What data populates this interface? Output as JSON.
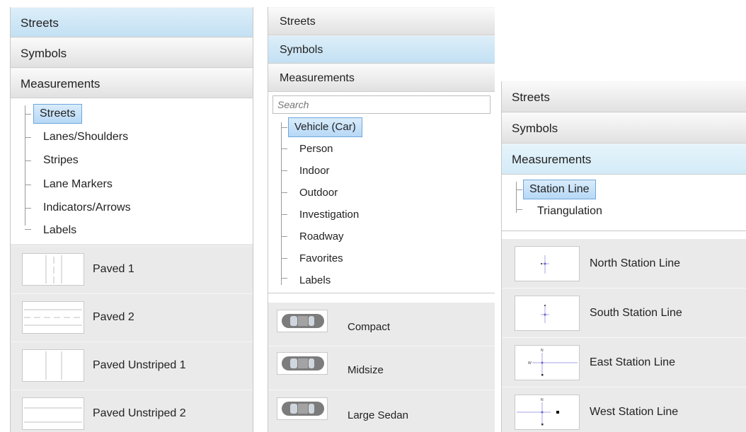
{
  "panel1": {
    "headers": [
      "Streets",
      "Symbols",
      "Measurements"
    ],
    "tree": [
      "Streets",
      "Lanes/Shoulders",
      "Stripes",
      "Lane Markers",
      "Indicators/Arrows",
      "Labels"
    ],
    "items": [
      "Paved 1",
      "Paved 2",
      "Paved Unstriped 1",
      "Paved Unstriped 2"
    ]
  },
  "panel2": {
    "headers": [
      "Streets",
      "Symbols",
      "Measurements"
    ],
    "search_placeholder": "Search",
    "tree": [
      "Vehicle (Car)",
      "Person",
      "Indoor",
      "Outdoor",
      "Investigation",
      "Roadway",
      "Favorites",
      "Labels"
    ],
    "items": [
      "Compact",
      "Midsize",
      "Large Sedan"
    ]
  },
  "panel3": {
    "headers": [
      "Streets",
      "Symbols",
      "Measurements"
    ],
    "tree": [
      "Station Line",
      "Triangulation"
    ],
    "items": [
      "North Station Line",
      "South Station Line",
      "East Station Line",
      "West Station Line"
    ],
    "compass_n": "N",
    "compass_w": "W"
  },
  "colors": {
    "selected_border": "#6ea6dc",
    "active_header": "#c3e0f3"
  }
}
